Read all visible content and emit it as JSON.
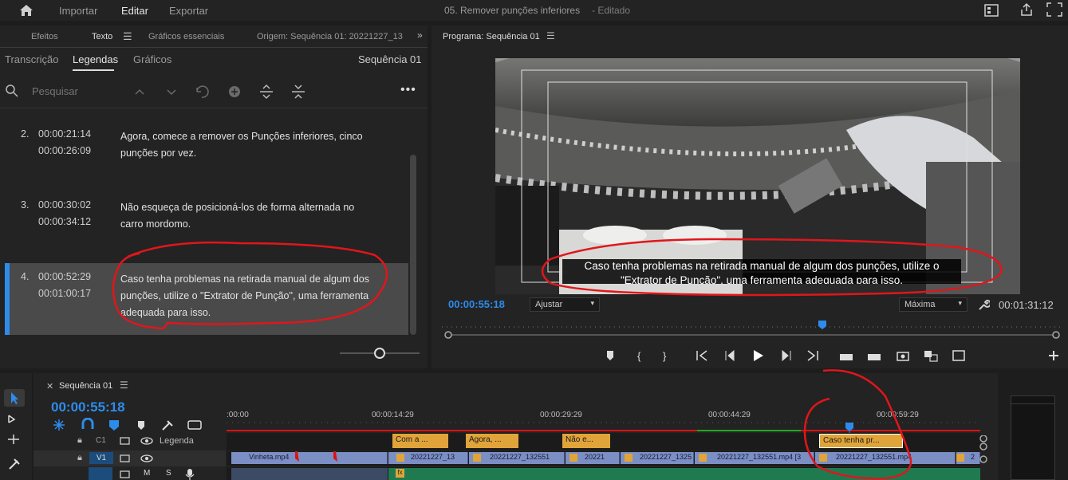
{
  "topbar": {
    "nav": [
      "Importar",
      "Editar",
      "Exportar"
    ],
    "title": "05. Remover punções inferiores",
    "status": "- Editado"
  },
  "left_panel": {
    "tabs": [
      "Efeitos",
      "Texto",
      "Gráficos essenciais",
      "Origem: Sequência 01: 20221227_13"
    ],
    "subtabs": [
      "Transcrição",
      "Legendas",
      "Gráficos"
    ],
    "sequence": "Sequência 01",
    "search_placeholder": "Pesquisar",
    "captions": [
      {
        "num": "2.",
        "in": "00:00:21:14",
        "out": "00:00:26:09",
        "text": "Agora, comece a remover os Punções inferiores, cinco punções por vez."
      },
      {
        "num": "3.",
        "in": "00:00:30:02",
        "out": "00:00:34:12",
        "text": "Não esqueça de posicioná-los de forma alternada no carro mordomo."
      },
      {
        "num": "4.",
        "in": "00:00:52:29",
        "out": "00:01:00:17",
        "text": "Caso tenha problemas na retirada manual de algum dos punções, utilize o \"Extrator de Punção\", uma ferramenta adequada para isso."
      }
    ]
  },
  "program": {
    "title": "Programa: Sequência 01",
    "subtitle_line1": "Caso tenha problemas na retirada manual de algum dos punções, utilize o",
    "subtitle_line2": "\"Extrator de Punção\", uma ferramenta adequada para isso.",
    "timecode": "00:00:55:18",
    "fit": "Ajustar",
    "quality": "Máxima",
    "duration": "00:01:31:12"
  },
  "timeline": {
    "title": "Sequência 01",
    "timecode": "00:00:55:18",
    "ruler": ":00:00",
    "ruler_marks": [
      "00:00:14:29",
      "00:00:29:29",
      "00:00:44:29",
      "00:00:59:29"
    ],
    "track_c1": "C1",
    "track_c1_name": "Legenda",
    "track_v1": "V1",
    "caption_clips": [
      "Com a ...",
      "Agora, ...",
      "Não e...",
      "Caso tenha pr..."
    ],
    "video_clips": [
      "Vinheta.mp4",
      "20221227_13",
      "20221227_132551",
      "20221",
      "20221227_1325",
      "20221227_132551.mp4 [3",
      "20221227_132551.mp4",
      "2"
    ],
    "fx": "fx",
    "a_track": [
      "M",
      "S"
    ]
  },
  "colors": {
    "accent_blue": "#2d8ceb",
    "clip_orange": "#e0a43a",
    "video_clip": "#7b8fc4",
    "annotation_red": "#e0161b"
  }
}
